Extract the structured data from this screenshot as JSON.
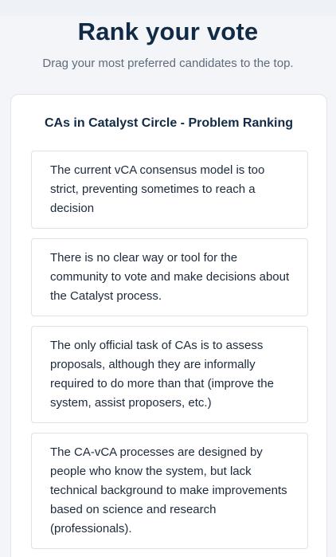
{
  "header": {
    "title": "Rank your vote",
    "subtitle": "Drag your most preferred candidates to the top."
  },
  "ballot": {
    "title": "CAs in Catalyst Circle - Problem Ranking",
    "candidates": [
      {
        "label": "The current vCA consensus model is too strict, preventing sometimes to reach a decision"
      },
      {
        "label": "There is no clear way or tool for the community to vote and make decisions about the Catalyst process."
      },
      {
        "label": "The only official task of CAs is to assess proposals, although they are informally required to do more than that (improve the system, assist proposers, etc.)"
      },
      {
        "label": "The CA-vCA processes are designed by people who know the system, but lack technical background to make improvements based on science and research (professionals)."
      }
    ]
  }
}
